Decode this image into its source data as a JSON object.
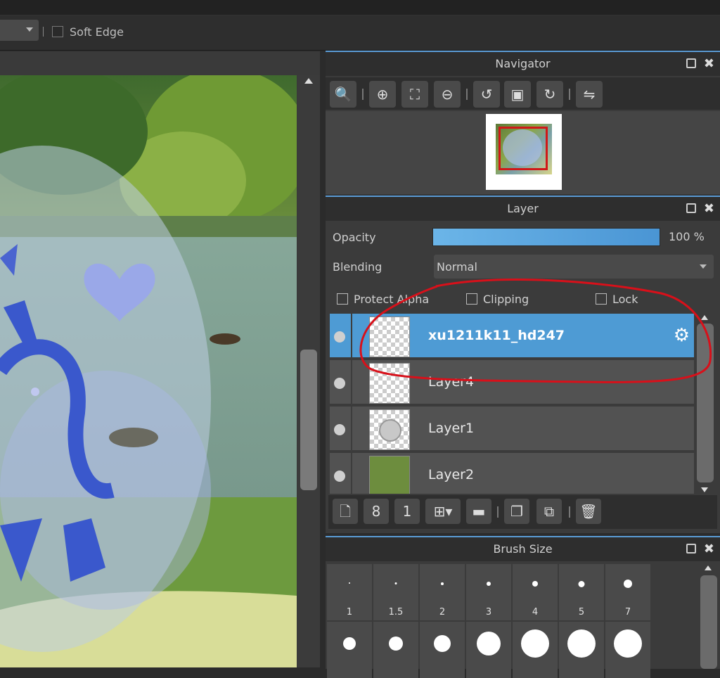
{
  "toolbar": {
    "soft_edge_label": "Soft Edge"
  },
  "navigator": {
    "title": "Navigator",
    "tools": [
      "zoom-actual-icon",
      "zoom-in-icon",
      "fit-icon",
      "zoom-out-icon",
      "rotate-left-icon",
      "reset-view-icon",
      "rotate-right-icon",
      "flip-icon"
    ]
  },
  "layer": {
    "title": "Layer",
    "opacity_label": "Opacity",
    "opacity_value": "100 %",
    "opacity": 1.0,
    "blending_label": "Blending",
    "blending_value": "Normal",
    "protect_alpha_label": "Protect Alpha",
    "clipping_label": "Clipping",
    "lock_label": "Lock",
    "items": [
      {
        "name": "xu1211k11_hd247",
        "selected": true
      },
      {
        "name": "Layer4",
        "selected": false
      },
      {
        "name": "Layer1",
        "selected": false
      },
      {
        "name": "Layer2",
        "selected": false
      }
    ],
    "tools": [
      "new-layer-icon",
      "new-8bit-layer-icon",
      "new-1bit-layer-icon",
      "add-layer-menu-icon",
      "folder-icon",
      "duplicate-icon",
      "merge-icon",
      "delete-icon"
    ]
  },
  "brush_size": {
    "title": "Brush Size",
    "sizes": [
      "1",
      "1.5",
      "2",
      "3",
      "4",
      "5",
      "7"
    ]
  },
  "colors": {
    "accent": "#5a9bd5",
    "selected_layer": "#4e9bd4",
    "annotation": "#d8101a"
  }
}
